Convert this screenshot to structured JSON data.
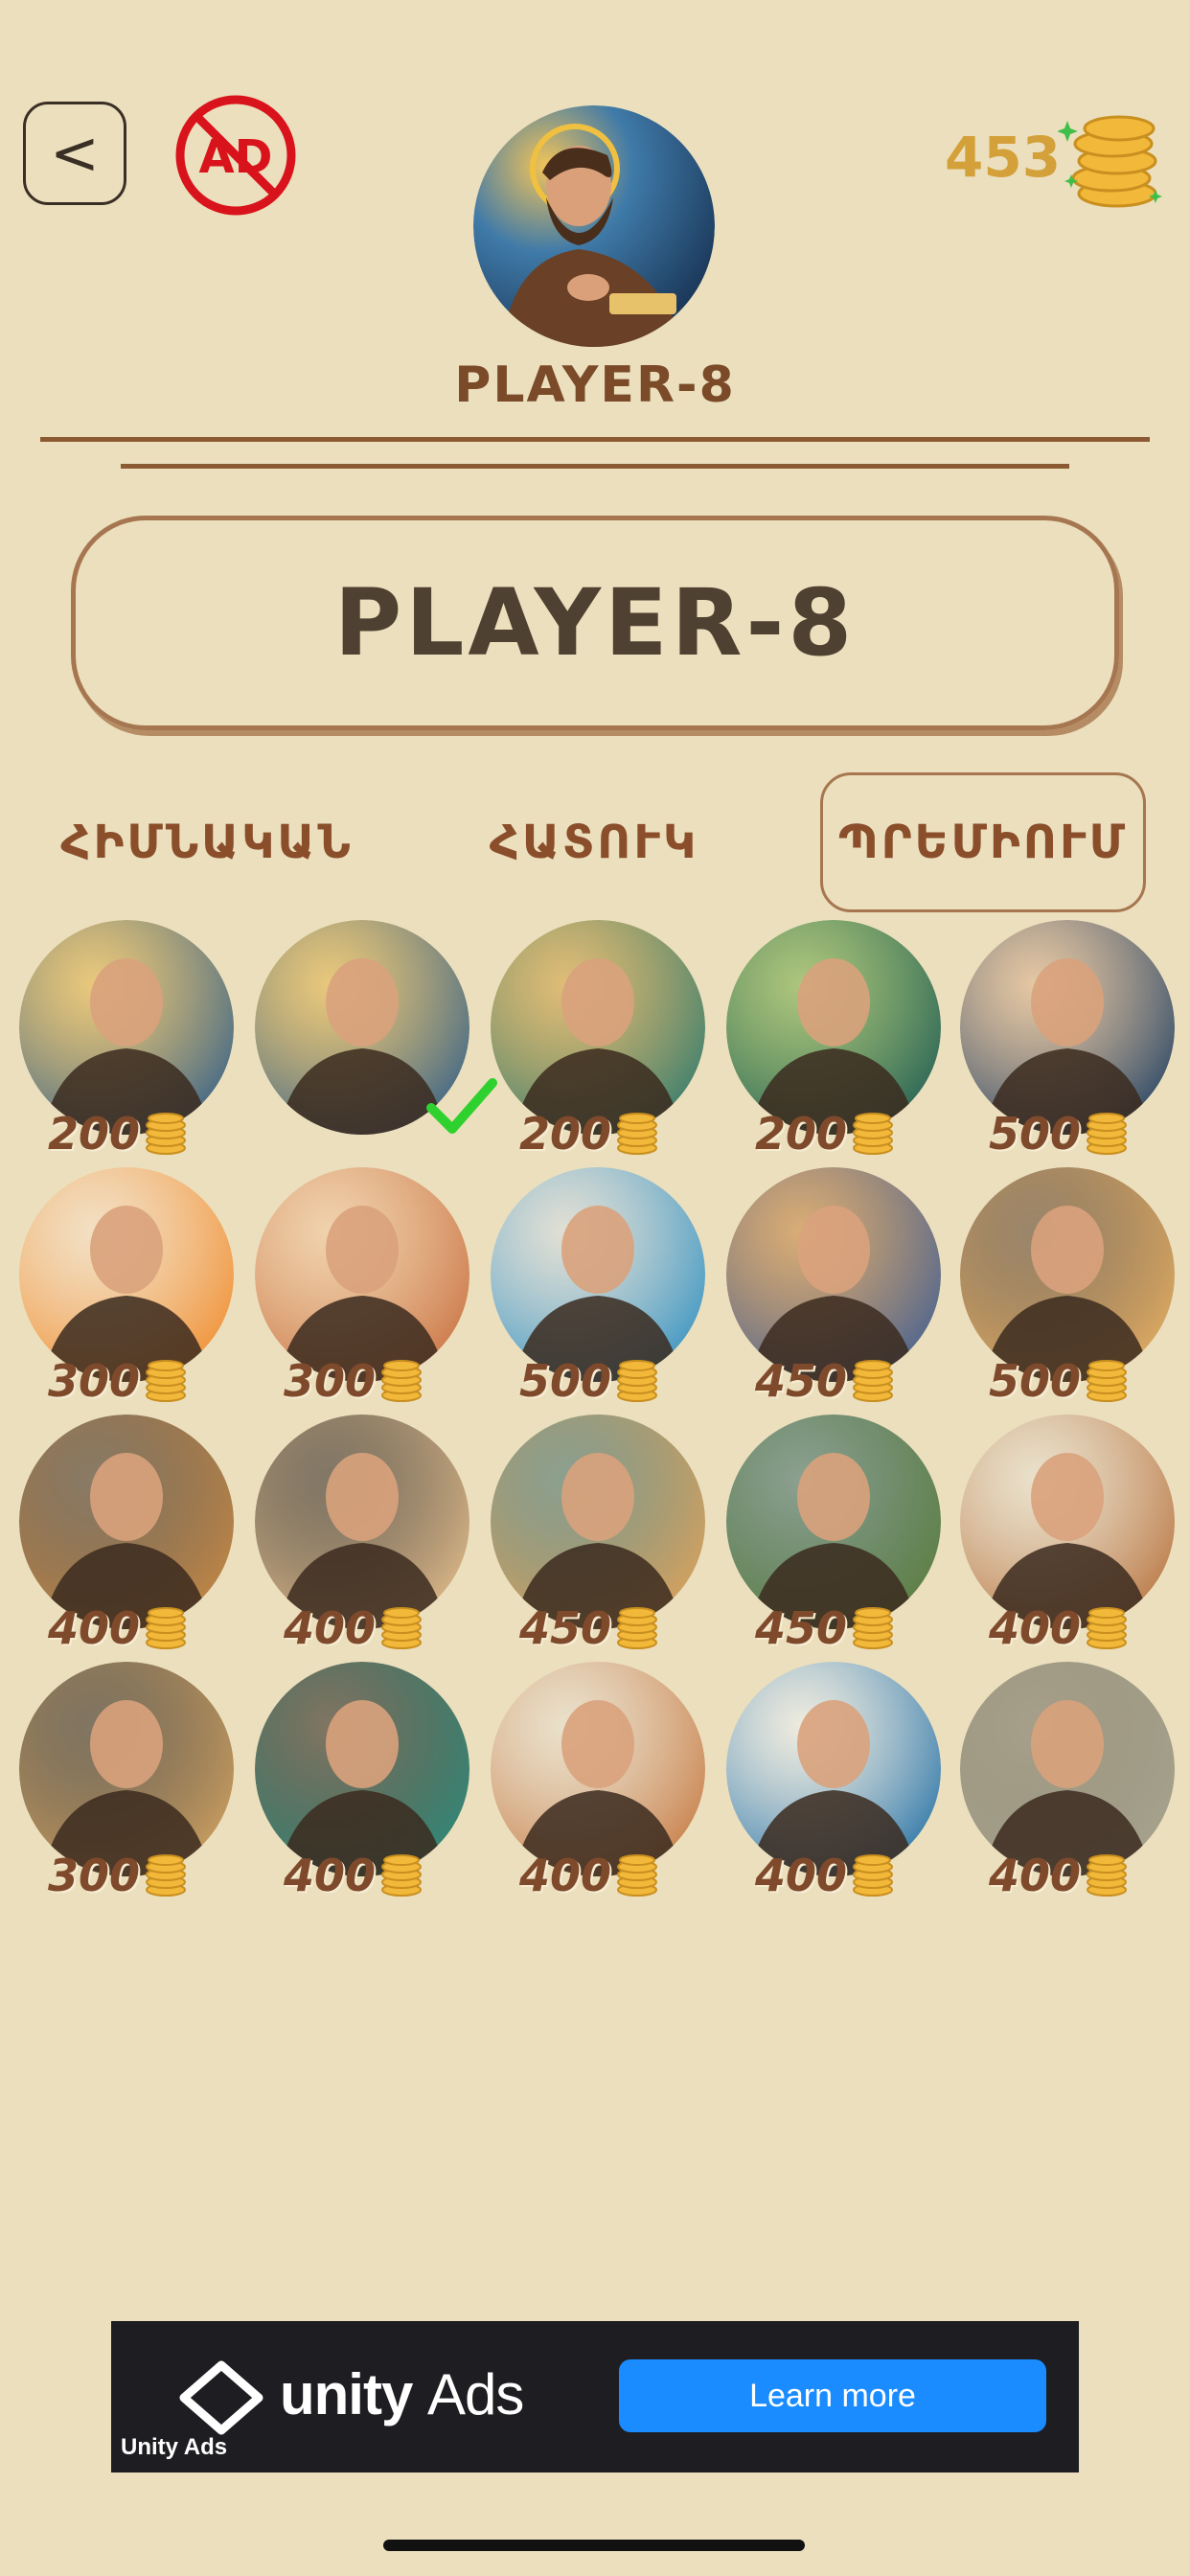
{
  "header": {
    "back_label": "<",
    "noad_label": "AD",
    "player_name": "PLAYER-8",
    "coins": "453"
  },
  "name_field": {
    "value": "PLAYER-8"
  },
  "tabs": [
    {
      "label": "ՀԻՄՆԱԿԱՆ",
      "selected": false
    },
    {
      "label": "ՀԱՏՈՒԿ",
      "selected": false
    },
    {
      "label": "ՊՐԵՄԻՈՒՄ",
      "selected": true
    }
  ],
  "avatars": [
    {
      "name": "saint-scholar-avatar",
      "price": "200",
      "selected": false,
      "colors": [
        "#2f5e8a",
        "#e7b548"
      ]
    },
    {
      "name": "saint-scholar-avatar-alt",
      "price": "",
      "selected": true,
      "colors": [
        "#2f5e8a",
        "#e7b548"
      ]
    },
    {
      "name": "archer-avatar",
      "price": "200",
      "selected": false,
      "colors": [
        "#2b7a6f",
        "#d6a040"
      ]
    },
    {
      "name": "green-archer-avatar",
      "price": "200",
      "selected": false,
      "colors": [
        "#1f5c55",
        "#7bb04a"
      ]
    },
    {
      "name": "priest-avatar",
      "price": "500",
      "selected": false,
      "colors": [
        "#1d3f63",
        "#e0b48e"
      ]
    },
    {
      "name": "old-man-cartoon-avatar",
      "price": "300",
      "selected": false,
      "colors": [
        "#f08b2a",
        "#f7e0c8"
      ]
    },
    {
      "name": "girl-cartoon-avatar",
      "price": "300",
      "selected": false,
      "colors": [
        "#c8703f",
        "#f3c8a0"
      ]
    },
    {
      "name": "penguin-avatar",
      "price": "500",
      "selected": false,
      "colors": [
        "#2e8fbf",
        "#d9dfe6"
      ]
    },
    {
      "name": "musician-avatar",
      "price": "450",
      "selected": false,
      "colors": [
        "#3f5f94",
        "#c9843e"
      ]
    },
    {
      "name": "gentleman-avatar",
      "price": "500",
      "selected": false,
      "colors": [
        "#e7b063",
        "#5a3e29"
      ]
    },
    {
      "name": "elder-portrait-avatar",
      "price": "400",
      "selected": false,
      "colors": [
        "#c88a45",
        "#3a2a20"
      ]
    },
    {
      "name": "curly-man-avatar",
      "price": "400",
      "selected": false,
      "colors": [
        "#e8c08d",
        "#2c2420"
      ]
    },
    {
      "name": "mouse-avatar",
      "price": "450",
      "selected": false,
      "colors": [
        "#e1a45a",
        "#3f6d6a"
      ]
    },
    {
      "name": "mouse-leaf-avatar",
      "price": "450",
      "selected": false,
      "colors": [
        "#5b7d3d",
        "#3f6d6a"
      ]
    },
    {
      "name": "bearded-sage-avatar",
      "price": "400",
      "selected": false,
      "colors": [
        "#b7713b",
        "#e9e2d6"
      ]
    },
    {
      "name": "mustache-man-avatar",
      "price": "300",
      "selected": false,
      "colors": [
        "#d4a462",
        "#2a2019"
      ]
    },
    {
      "name": "glasses-man-avatar",
      "price": "400",
      "selected": false,
      "colors": [
        "#2d8c7c",
        "#2a2019"
      ]
    },
    {
      "name": "old-mustache-avatar",
      "price": "400",
      "selected": false,
      "colors": [
        "#c6783f",
        "#e9e2d6"
      ]
    },
    {
      "name": "mountain-avatar",
      "price": "400",
      "selected": false,
      "colors": [
        "#1f6da3",
        "#f0f4f8"
      ]
    },
    {
      "name": "monument-avatar",
      "price": "400",
      "selected": false,
      "colors": [
        "#a8a48e",
        "#6f6b5e"
      ]
    }
  ],
  "ad": {
    "brand": "unity",
    "brand_suffix": "Ads",
    "cta": "Learn more",
    "footer_brand": "Unity Ads"
  },
  "colors": {
    "background": "#ebdfbd",
    "accent_brown": "#8a4e2b",
    "coin_gold": "#d3a03a",
    "selected_check": "#2fd12f",
    "ad_button": "#1a8cff"
  }
}
